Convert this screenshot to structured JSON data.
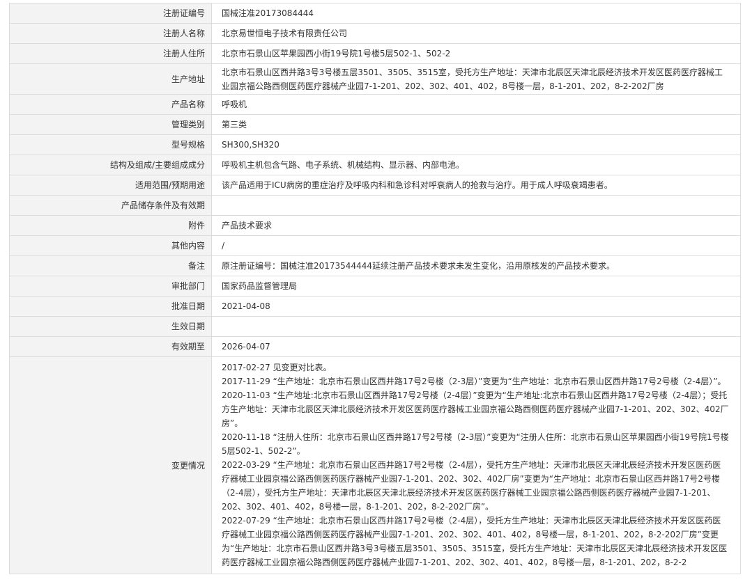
{
  "fields": [
    {
      "key": "reg_no",
      "label": "注册证编号",
      "value": "国械注准20173084444"
    },
    {
      "key": "registrant",
      "label": "注册人名称",
      "value": "北京易世恒电子技术有限责任公司"
    },
    {
      "key": "registrant_address",
      "label": "注册人住所",
      "value": "北京市石景山区苹果园西小街19号院1号楼5层502-1、502-2"
    },
    {
      "key": "production_address",
      "label": "生产地址",
      "value": "北京市石景山区西井路3号3号楼五层3501、3505、3515室，受托方生产地址：天津市北辰区天津北辰经济技术开发区医药医疗器械工业园京福公路西侧医药医疗器械产业园7-1-201、202、302、401、402，8号楼一层，8-1-201、202，8-2-202厂房"
    },
    {
      "key": "product_name",
      "label": "产品名称",
      "value": "呼吸机"
    },
    {
      "key": "category",
      "label": "管理类别",
      "value": "第三类"
    },
    {
      "key": "model",
      "label": "型号规格",
      "value": "SH300,SH320"
    },
    {
      "key": "structure",
      "label": "结构及组成/主要组成成分",
      "value": "呼吸机主机包含气路、电子系统、机械结构、显示器、内部电池。"
    },
    {
      "key": "scope",
      "label": "适用范围/预期用途",
      "value": "该产品适用于ICU病房的重症治疗及呼吸内科和急诊科对呼衰病人的抢救与治疗。用于成人呼吸衰竭患者。"
    },
    {
      "key": "storage",
      "label": "产品储存条件及有效期",
      "value": ""
    },
    {
      "key": "attachment",
      "label": "附件",
      "value": "产品技术要求"
    },
    {
      "key": "other",
      "label": "其他内容",
      "value": "/"
    },
    {
      "key": "remarks",
      "label": "备注",
      "value": "原注册证编号：国械注准20173544444延续注册产品技术要求未发生变化，沿用原核发的产品技术要求。"
    },
    {
      "key": "authority",
      "label": "审批部门",
      "value": "国家药品监督管理局"
    },
    {
      "key": "approval_date",
      "label": "批准日期",
      "value": "2021-04-08"
    },
    {
      "key": "effective_date",
      "label": "生效日期",
      "value": ""
    },
    {
      "key": "expiry_date",
      "label": "有效期至",
      "value": "2026-04-07"
    }
  ],
  "changes": {
    "label": "变更情况",
    "entries": [
      "2017-02-27 见变更对比表。",
      "2017-11-29 “生产地址：北京市石景山区西井路17号2号楼（2-3层）”变更为“生产地址：北京市石景山区西井路17号2号楼（2-4层）”。",
      "2020-11-03 “生产地址:北京市石景山区西井路17号2号楼（2-4层）”变更为“生产地址:北京市石景山区西井路17号2号楼（2-4层）；受托方生产地址：天津市北辰区天津北辰经济技术开发区医药医疗器械工业园京福公路西侧医药医疗器械产业园7-1-201、202、302、402厂房”。",
      "2020-11-18 “注册人住所：北京市石景山区西井路17号2号楼（2-3层）”变更为“注册人住所：北京市石景山区苹果园西小街19号院1号楼5层502-1、502-2”。",
      "2022-03-29 “生产地址：北京市石景山区西井路17号2号楼（2-4层），受托方生产地址：天津市北辰区天津北辰经济技术开发区医药医疗器械工业园京福公路西侧医药医疗器械产业园7-1-201、202、302、402厂房”变更为“生产地址：北京市石景山区西井路17号2号楼（2-4层），受托方生产地址：天津市北辰区天津北辰经济技术开发区医药医疗器械工业园京福公路西侧医药医疗器械产业园7-1-201、202、302、401、402，8号楼一层，8-1-201、202，8-2-202厂房”。",
      "2022-07-29 “生产地址：北京市石景山区西井路17号2号楼（2-4层），受托方生产地址：天津市北辰区天津北辰经济技术开发区医药医疗器械工业园京福公路西侧医药医疗器械产业园7-1-201、202、302、401、402，8号楼一层，8-1-201、202，8-2-202厂房”变更为“生产地址：北京市石景山区西井路3号3号楼五层3501、3505、3515室，受托方生产地址：天津市北辰区天津北辰经济技术开发区医药医疗器械工业园京福公路西侧医药医疗器械产业园7-1-201、202、302、401、402，8号楼一层，8-1-201、202，8-2-2"
    ]
  }
}
